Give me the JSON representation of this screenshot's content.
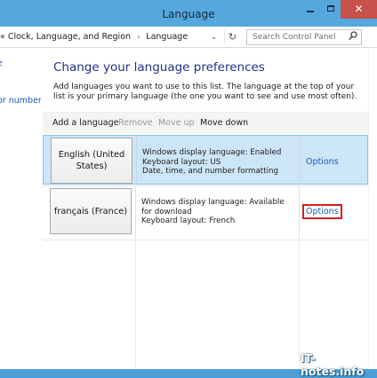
{
  "window": {
    "title": "Language",
    "close_glyph": "✕"
  },
  "address": {
    "crumbs": [
      "Clock, Language, and Region",
      "Language"
    ],
    "leading": "«",
    "separator": "›",
    "dropdown_glyph": "⌄",
    "refresh_glyph": "↻",
    "search_placeholder": "Search Control Panel",
    "search_icon": "search-icon"
  },
  "sidebar": {
    "link1": "e",
    "link2": "or number"
  },
  "main": {
    "heading": "Change your language preferences",
    "description": "Add languages you want to use to this list. The language at the top of your list is your primary language (the one you want to see and use most often)."
  },
  "toolbar": {
    "add": "Add a language",
    "remove": "Remove",
    "move_up": "Move up",
    "move_down": "Move down"
  },
  "languages": [
    {
      "name": "English (United States)",
      "line1": "Windows display language: Enabled",
      "line2": "Keyboard layout: US",
      "line3": "Date, time, and number formatting",
      "options": "Options"
    },
    {
      "name": "français (France)",
      "line1": "Windows display language: Available for download",
      "line2": "Keyboard layout: French",
      "line3": "",
      "options": "Options"
    }
  ],
  "watermark": "IT-notes.info",
  "colors": {
    "title_bar": "#55a8dd",
    "close_button": "#c7504a",
    "selected_row": "#cde6f7",
    "link": "#1a5ab5",
    "heading": "#1e3287",
    "highlight_box": "#d62020"
  }
}
